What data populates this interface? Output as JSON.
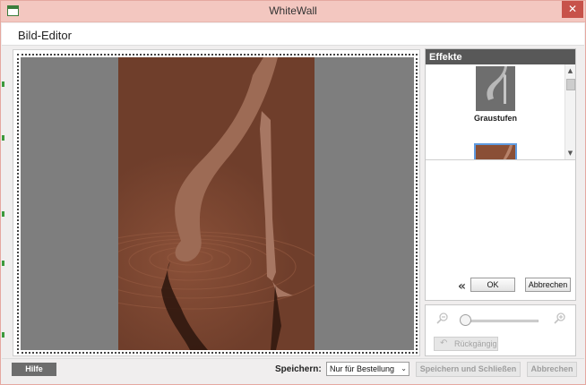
{
  "window": {
    "title": "WhiteWall",
    "close_glyph": "✕"
  },
  "header": {
    "title": "Bild-Editor"
  },
  "canvas": {
    "photo_description_tone": "sepia"
  },
  "effects": {
    "heading": "Effekte",
    "items": [
      {
        "label": "Graustufen",
        "icon": "grayscale-thumbnail"
      },
      {
        "label": "",
        "icon": "sepia-thumbnail",
        "selected": true
      }
    ],
    "scroll_up": "▲",
    "scroll_down": "▼",
    "back_chevrons": "«",
    "ok_label": "OK",
    "cancel_label": "Abbrechen"
  },
  "zoom": {
    "zoom_out_icon": "zoom-out-icon",
    "zoom_in_icon": "zoom-in-icon",
    "level_fraction": 0.0,
    "undo_label": "Rückgängig"
  },
  "footer": {
    "help_label": "Hilfe",
    "save_label": "Speichern:",
    "save_option": "Nur für Bestellung",
    "save_close_label": "Speichern und Schließen",
    "abort_label": "Abbrechen"
  },
  "colors": {
    "titlebar": "#f3c7c0",
    "close": "#c7524a",
    "photo_sepia": "#7a4531",
    "effects_header": "#585858"
  }
}
